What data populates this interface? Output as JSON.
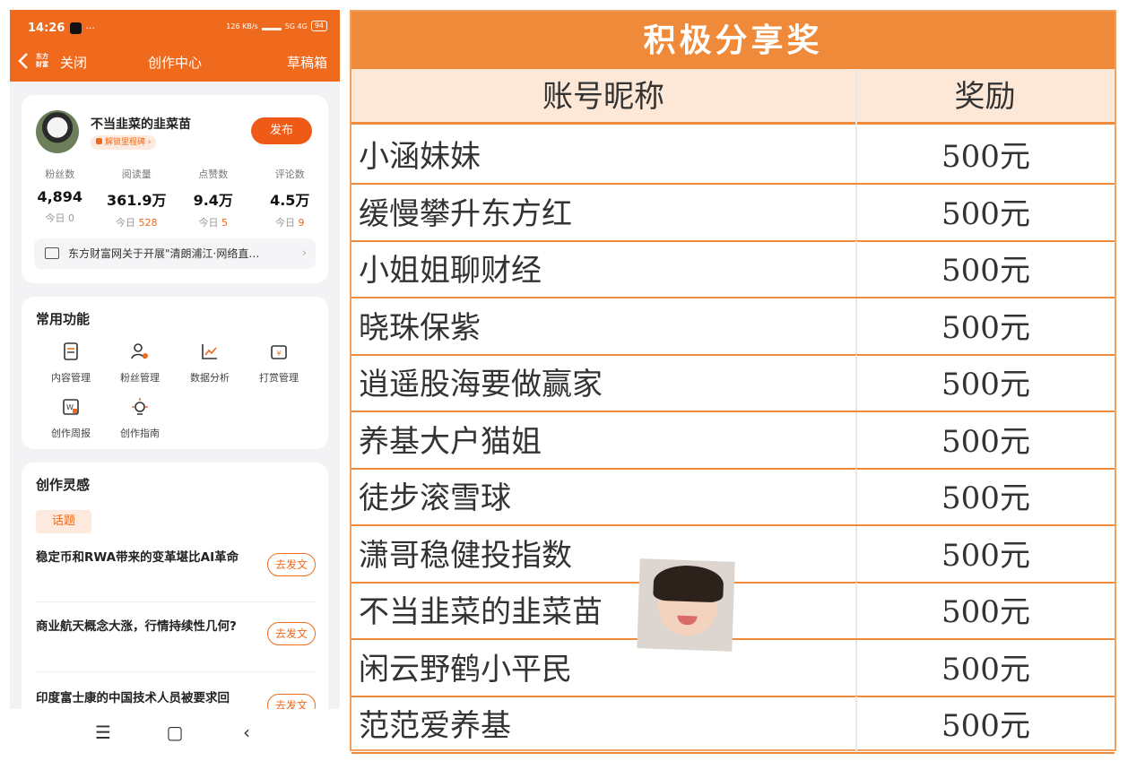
{
  "status": {
    "time": "14:26",
    "dots": "···",
    "speed": "126\nKB/s",
    "net": "5G 4G",
    "battery": "94"
  },
  "nav": {
    "close": "关闭",
    "title": "创作中心",
    "drafts": "草稿箱",
    "logo": "东方财富"
  },
  "profile": {
    "username": "不当韭菜的韭菜苗",
    "unlock_tag": "解锁里程碑",
    "publish": "发布",
    "stats": [
      {
        "label": "粉丝数",
        "value": "4,894",
        "today_label": "今日",
        "today": "0",
        "hot": false
      },
      {
        "label": "阅读量",
        "value": "361.9万",
        "today_label": "今日",
        "today": "528",
        "hot": true
      },
      {
        "label": "点赞数",
        "value": "9.4万",
        "today_label": "今日",
        "today": "5",
        "hot": true
      },
      {
        "label": "评论数",
        "value": "4.5万",
        "today_label": "今日",
        "today": "9",
        "hot": true
      }
    ],
    "notice": "东方财富网关于开展\"清朗浦江·网络直…"
  },
  "functions": {
    "title": "常用功能",
    "items": [
      "内容管理",
      "粉丝管理",
      "数据分析",
      "打赏管理",
      "创作周报",
      "创作指南"
    ]
  },
  "inspiration": {
    "title": "创作灵感",
    "tag": "话题",
    "go_label": "去发文",
    "topics": [
      "稳定币和RWA带来的变革堪比AI革命",
      "商业航天概念大涨，行情持续性几何?",
      "印度富士康的中国技术人员被要求回"
    ]
  },
  "award": {
    "title": "积极分享奖",
    "header_name": "账号昵称",
    "header_reward": "奖励",
    "rows": [
      {
        "name": "小涵妹妹",
        "reward": "500元"
      },
      {
        "name": "缓慢攀升东方红",
        "reward": "500元"
      },
      {
        "name": "小姐姐聊财经",
        "reward": "500元"
      },
      {
        "name": "晓珠保紫",
        "reward": "500元"
      },
      {
        "name": "逍遥股海要做赢家",
        "reward": "500元"
      },
      {
        "name": "养基大户猫姐",
        "reward": "500元"
      },
      {
        "name": "徒步滚雪球",
        "reward": "500元"
      },
      {
        "name": "潇哥稳健投指数",
        "reward": "500元"
      },
      {
        "name": "不当韭菜的韭菜苗",
        "reward": "500元"
      },
      {
        "name": "闲云野鹤小平民",
        "reward": "500元"
      },
      {
        "name": "范范爱养基",
        "reward": "500元"
      }
    ]
  },
  "colors": {
    "brand": "#ef6a1c",
    "table_header": "#ef8a3a"
  }
}
